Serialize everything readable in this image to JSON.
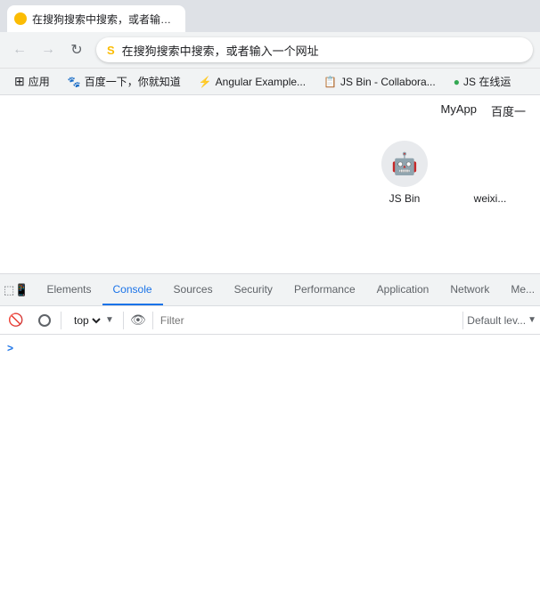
{
  "browser": {
    "tab": {
      "favicon_color": "#fbbc04",
      "title": "在搜狗搜索中搜索，或者输入一个网址"
    },
    "nav": {
      "back_label": "←",
      "forward_label": "→",
      "reload_label": "↻",
      "address_icon": "S",
      "address_text": "在搜狗搜索中搜索，或者输入一个网址"
    },
    "bookmarks": [
      {
        "icon": "⊞",
        "label": "应用"
      },
      {
        "icon": "🐾",
        "label": "百度一下，你就知道"
      },
      {
        "icon": "⚡",
        "label": "Angular Example..."
      },
      {
        "icon": "📋",
        "label": "JS Bin - Collabora..."
      },
      {
        "icon": "🟢",
        "label": "JS 在线运"
      }
    ]
  },
  "page": {
    "top_links": [
      "MyApp",
      "百度一"
    ],
    "cards": [
      {
        "icon": "🤖",
        "label": "JS Bin",
        "sublabel": "weixi..."
      }
    ]
  },
  "devtools": {
    "toolbar_tabs": [
      {
        "id": "elements",
        "label": "Elements",
        "active": false
      },
      {
        "id": "console",
        "label": "Console",
        "active": true
      },
      {
        "id": "sources",
        "label": "Sources",
        "active": false
      },
      {
        "id": "security",
        "label": "Security",
        "active": false
      },
      {
        "id": "performance",
        "label": "Performance",
        "active": false
      },
      {
        "id": "application",
        "label": "Application",
        "active": false
      },
      {
        "id": "network",
        "label": "Network",
        "active": false
      },
      {
        "id": "more",
        "label": "Me...",
        "active": false
      }
    ],
    "console": {
      "context": "top",
      "filter_placeholder": "Filter",
      "default_level": "Default lev..."
    }
  }
}
